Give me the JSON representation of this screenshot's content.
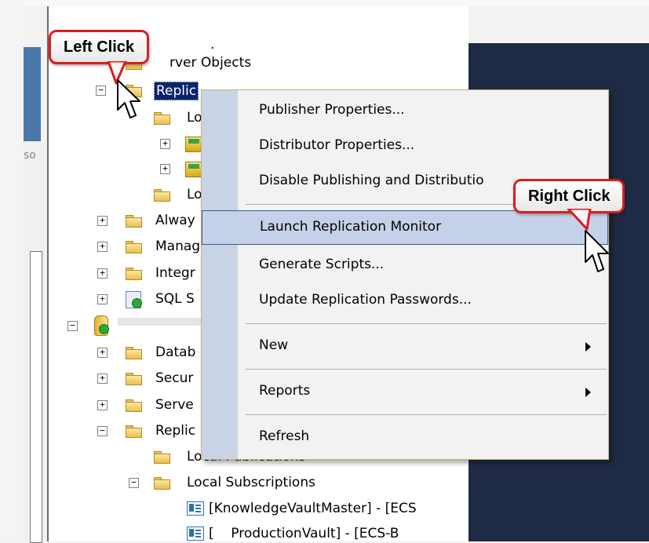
{
  "callouts": {
    "left_click": "Left Click",
    "right_click": "Right Click"
  },
  "sidebar": {
    "clipped_label": "so"
  },
  "tree": {
    "dot": ".",
    "server_objects": "rver Objects",
    "replication_selected": "Replic",
    "local_pub_1": "Lo",
    "local_sub_1": "Lo",
    "always_on": "Alway",
    "management": "Manag",
    "integration": "Integr",
    "sql_agent": "SQL S",
    "databases": "Datab",
    "security": "Secur",
    "server_objects_2": "Serve",
    "replication_2": "Replic",
    "local_pub_2": "Local Publications",
    "local_subscriptions": "Local Subscriptions",
    "sub_item_1": "[KnowledgeVaultMaster] - [ECS",
    "sub_item_2": "[    ProductionVault] - [ECS-B"
  },
  "context_menu": {
    "items": [
      "Publisher Properties...",
      "Distributor Properties...",
      "Disable Publishing and Distributio",
      "Launch Replication Monitor",
      "Generate Scripts...",
      "Update Replication Passwords...",
      "New",
      "Reports",
      "Refresh"
    ],
    "highlighted_index": 3
  },
  "colors": {
    "callout_border": "#d81e1e",
    "menu_highlight": "#c5d1e8",
    "dark_panel": "#1f2a44",
    "blue_bar": "#4a79a9"
  },
  "icons": [
    "folder-icon",
    "publication-icon",
    "subscription-icon",
    "server-icon",
    "agent-icon",
    "expand-icon",
    "collapse-icon",
    "submenu-arrow-icon",
    "mouse-cursor-icon"
  ]
}
